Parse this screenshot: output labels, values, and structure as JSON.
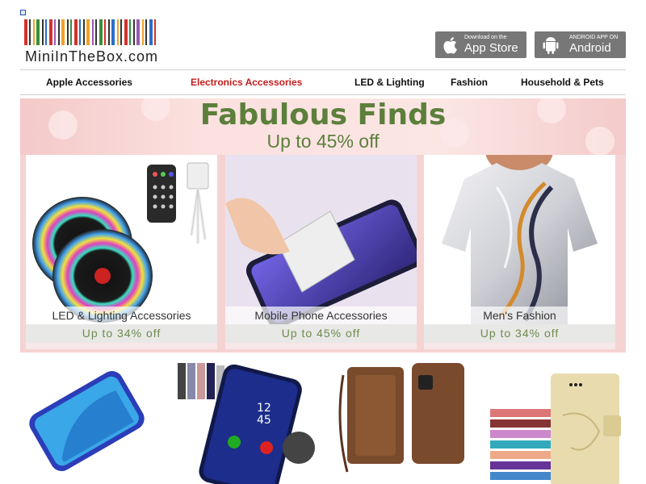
{
  "header": {
    "logo_text": "MiniInTheBox.com",
    "barcode_colors": [
      "#d0342c",
      "#333",
      "#f3a12a",
      "#3a8f3a",
      "#333",
      "#2a6fc9",
      "#d0342c",
      "#9c59b6",
      "#333",
      "#f3a12a",
      "#333",
      "#3a8f3a",
      "#d0342c",
      "#2a6fc9",
      "#333",
      "#f3a12a",
      "#9c59b6",
      "#333",
      "#3a8f3a",
      "#d0342c",
      "#333",
      "#2a6fc9",
      "#f3a12a",
      "#333",
      "#d0342c",
      "#3a8f3a",
      "#333",
      "#9c59b6",
      "#f3a12a",
      "#333",
      "#2a6fc9",
      "#d0342c"
    ],
    "app_store": {
      "small": "Download on the",
      "big": "App Store"
    },
    "android": {
      "small": "ANDROID APP ON",
      "big": "Android"
    }
  },
  "nav": {
    "items": [
      {
        "label": "Apple Accessories",
        "active": false
      },
      {
        "label": "Electronics Accessories",
        "active": true
      },
      {
        "label": "LED & Lighting",
        "active": false
      },
      {
        "label": "Fashion",
        "active": false
      },
      {
        "label": "Household & Pets",
        "active": false
      }
    ]
  },
  "banner": {
    "title": "Fabulous Finds",
    "subtitle": "Up to 45% off",
    "cards": [
      {
        "caption": "LED & Lighting Accessories",
        "discount": "Up to 34% off"
      },
      {
        "caption": "Mobile Phone Accessories",
        "discount": "Up to 45% off"
      },
      {
        "caption": "Men's Fashion",
        "discount": "Up to 34% off"
      }
    ]
  },
  "colors": {
    "active_nav": "#c41c1c",
    "banner_green": "#5c7f3b",
    "banner_pink": "#f6d3d3",
    "app_button": "#777777"
  }
}
